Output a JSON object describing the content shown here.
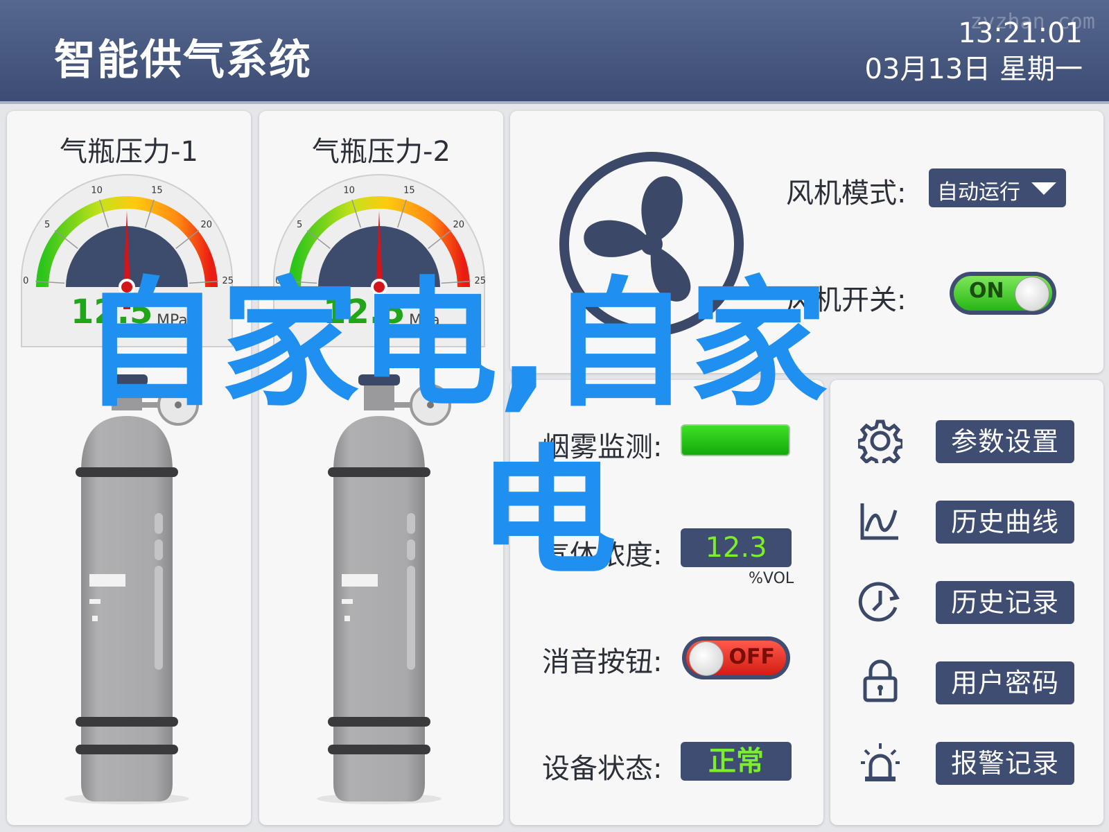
{
  "header": {
    "title": "智能供气系统",
    "time": "13:21:01",
    "date": "03月13日  星期一",
    "watermark": "zyzhan.com"
  },
  "gauges": [
    {
      "title": "气瓶压力-1",
      "value": "12.5",
      "unit": "MPa",
      "reading": 12.5,
      "ticks": [
        "0",
        "5",
        "10",
        "15",
        "20",
        "25"
      ]
    },
    {
      "title": "气瓶压力-2",
      "value": "12.5",
      "unit": "MPa",
      "reading": 12.5,
      "ticks": [
        "0",
        "5",
        "10",
        "15",
        "20",
        "25"
      ]
    }
  ],
  "fan": {
    "mode_label": "风机模式:",
    "mode_value": "自动运行",
    "switch_label": "风机开关:",
    "switch_state": "ON"
  },
  "monitor": {
    "smoke_label": "烟雾监测:",
    "concentration_label": "气体浓度:",
    "concentration_value": "12.3",
    "concentration_unit": "%VOL",
    "mute_label": "消音按钮:",
    "mute_state": "OFF",
    "status_label": "设备状态:",
    "status_value": "正常"
  },
  "menu": [
    {
      "label": "参数设置",
      "icon": "gear-icon"
    },
    {
      "label": "历史曲线",
      "icon": "chart-icon"
    },
    {
      "label": "历史记录",
      "icon": "clock-history-icon"
    },
    {
      "label": "用户密码",
      "icon": "lock-icon"
    },
    {
      "label": "报警记录",
      "icon": "alarm-icon"
    }
  ],
  "overlay": {
    "line1": "自家电,自家",
    "line2": "电"
  },
  "colors": {
    "header": "#3c4c72",
    "button": "#3f4d73",
    "value_green": "#7bef2c",
    "gauge_value": "#21a619",
    "overlay_blue": "#1f8ff0"
  }
}
